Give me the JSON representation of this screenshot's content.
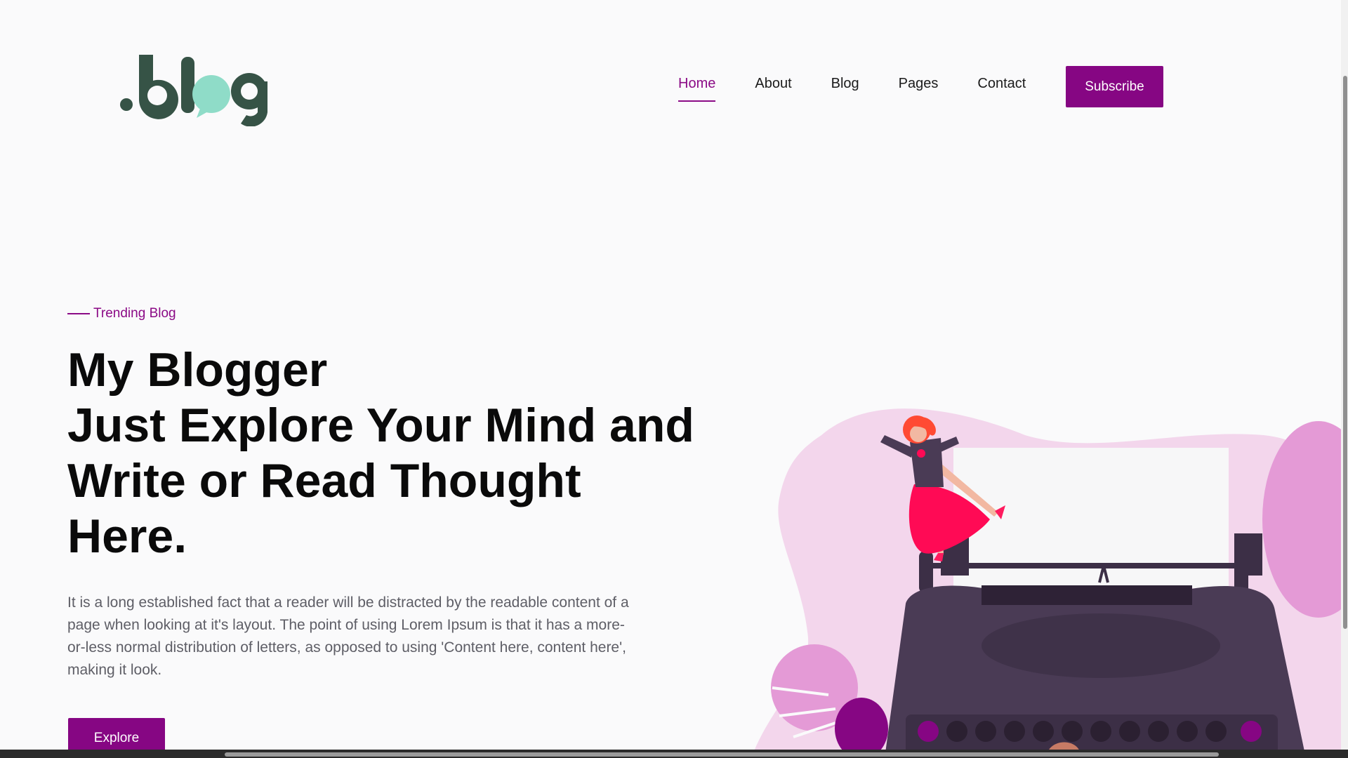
{
  "brand": {
    "logo_text": ".blog",
    "colors": {
      "logo_dark": "#365346",
      "logo_accent": "#8fdcc8"
    }
  },
  "nav": {
    "items": [
      {
        "label": "Home",
        "active": true
      },
      {
        "label": "About",
        "active": false
      },
      {
        "label": "Blog",
        "active": false
      },
      {
        "label": "Pages",
        "active": false
      },
      {
        "label": "Contact",
        "active": false
      }
    ],
    "subscribe_label": "Subscribe"
  },
  "hero": {
    "eyebrow": "Trending Blog",
    "headline_lines": [
      "My Blogger",
      "Just Explore Your Mind and",
      "Write or Read Thought",
      "Here."
    ],
    "description": "It is a long established fact that a reader will be distracted by the readable content of a page when looking at it's layout. The point of using Lorem Ipsum is that it has a more-or-less normal distribution of letters, as opposed to using 'Content here, content here', making it look.",
    "explore_label": "Explore"
  },
  "illustration": {
    "icon": "woman-on-typewriter-illustration"
  },
  "theme": {
    "accent": "#860683",
    "text_dark": "#0a0a0a",
    "text_muted": "#5e5e66",
    "background": "#fafafb",
    "blob_light": "#f3d6ec",
    "blob_mid": "#e49ad6",
    "typewriter": "#4a3b55"
  }
}
